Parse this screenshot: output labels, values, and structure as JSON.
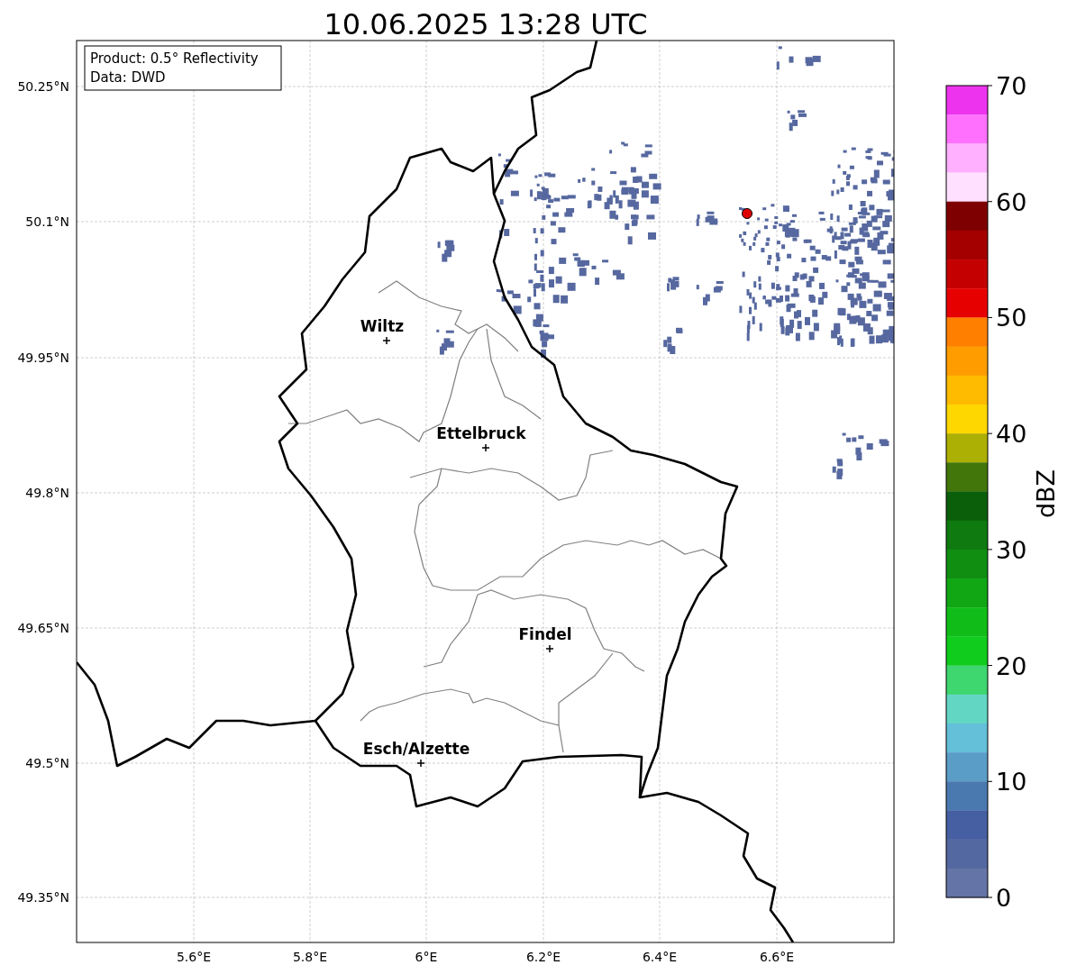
{
  "title": "10.06.2025 13:28 UTC",
  "info_box": [
    "Product: 0.5° Reflectivity",
    "Data: DWD"
  ],
  "lat_labels": [
    "50.25°N",
    "50.1°N",
    "49.95°N",
    "49.8°N",
    "49.65°N",
    "49.5°N",
    "49.35°N"
  ],
  "lon_labels": [
    "5.6°E",
    "5.8°E",
    "6°E",
    "6.2°E",
    "6.4°E",
    "6.6°E"
  ],
  "cities": [
    {
      "name": "Wiltz"
    },
    {
      "name": "Ettelbruck"
    },
    {
      "name": "Findel"
    },
    {
      "name": "Esch/Alzette"
    }
  ],
  "colorbar": {
    "label": "dBZ",
    "ticks": [
      "70",
      "60",
      "50",
      "40",
      "30",
      "20",
      "10",
      "0"
    ],
    "colors": [
      {
        "color": "#ee33ee"
      },
      {
        "color": "#ff70ff"
      },
      {
        "color": "#ffb0ff"
      },
      {
        "color": "#ffe0ff"
      },
      {
        "color": "#7f0000"
      },
      {
        "color": "#a50000"
      },
      {
        "color": "#c50000"
      },
      {
        "color": "#e60000"
      },
      {
        "color": "#ff7f00"
      },
      {
        "color": "#ff9d00"
      },
      {
        "color": "#ffbb00"
      },
      {
        "color": "#ffd700"
      },
      {
        "color": "#adb004"
      },
      {
        "color": "#42760a"
      },
      {
        "color": "#0b5f0b"
      },
      {
        "color": "#0f7a0f"
      },
      {
        "color": "#108e12"
      },
      {
        "color": "#10a614"
      },
      {
        "color": "#10bd18"
      },
      {
        "color": "#10cc1c"
      },
      {
        "color": "#3ed66e"
      },
      {
        "color": "#63d6c3"
      },
      {
        "color": "#64bfd9"
      },
      {
        "color": "#5a9dc7"
      },
      {
        "color": "#4a79b0"
      },
      {
        "color": "#465fa2"
      },
      {
        "color": "#5368a0"
      },
      {
        "color": "#6474a6"
      }
    ]
  }
}
